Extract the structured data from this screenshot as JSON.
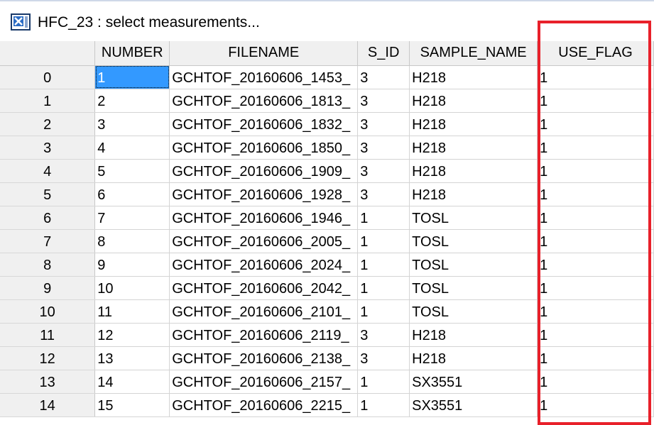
{
  "window": {
    "title": "HFC_23 : select measurements...",
    "icon": "app-icon"
  },
  "table": {
    "columns": [
      "NUMBER",
      "FILENAME",
      "S_ID",
      "SAMPLE_NAME",
      "USE_FLAG"
    ],
    "rows": [
      {
        "index": "0",
        "cells": [
          "1",
          "GCHTOF_20160606_1453_",
          "3",
          "H218",
          "1"
        ]
      },
      {
        "index": "1",
        "cells": [
          "2",
          "GCHTOF_20160606_1813_",
          "3",
          "H218",
          "1"
        ]
      },
      {
        "index": "2",
        "cells": [
          "3",
          "GCHTOF_20160606_1832_",
          "3",
          "H218",
          "1"
        ]
      },
      {
        "index": "3",
        "cells": [
          "4",
          "GCHTOF_20160606_1850_",
          "3",
          "H218",
          "1"
        ]
      },
      {
        "index": "4",
        "cells": [
          "5",
          "GCHTOF_20160606_1909_",
          "3",
          "H218",
          "1"
        ]
      },
      {
        "index": "5",
        "cells": [
          "6",
          "GCHTOF_20160606_1928_",
          "3",
          "H218",
          "1"
        ]
      },
      {
        "index": "6",
        "cells": [
          "7",
          "GCHTOF_20160606_1946_",
          "1",
          "TOSL",
          "1"
        ]
      },
      {
        "index": "7",
        "cells": [
          "8",
          "GCHTOF_20160606_2005_",
          "1",
          "TOSL",
          "1"
        ]
      },
      {
        "index": "8",
        "cells": [
          "9",
          "GCHTOF_20160606_2024_",
          "1",
          "TOSL",
          "1"
        ]
      },
      {
        "index": "9",
        "cells": [
          "10",
          "GCHTOF_20160606_2042_",
          "1",
          "TOSL",
          "1"
        ]
      },
      {
        "index": "10",
        "cells": [
          "11",
          "GCHTOF_20160606_2101_",
          "1",
          "TOSL",
          "1"
        ]
      },
      {
        "index": "11",
        "cells": [
          "12",
          "GCHTOF_20160606_2119_",
          "3",
          "H218",
          "1"
        ]
      },
      {
        "index": "12",
        "cells": [
          "13",
          "GCHTOF_20160606_2138_",
          "3",
          "H218",
          "1"
        ]
      },
      {
        "index": "13",
        "cells": [
          "14",
          "GCHTOF_20160606_2157_",
          "1",
          "SX3551",
          "1"
        ]
      },
      {
        "index": "14",
        "cells": [
          "15",
          "GCHTOF_20160606_2215_",
          "1",
          "SX3551",
          "1"
        ]
      }
    ],
    "selected_cell": {
      "row": 0,
      "col": 0
    }
  },
  "colors": {
    "selection": "#3399ff",
    "highlight_box": "#e8202a",
    "header_bg": "#f0f0f0"
  }
}
